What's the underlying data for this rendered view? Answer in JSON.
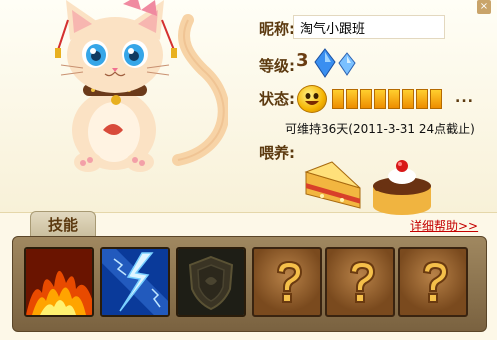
{
  "info": {
    "nickname_label": "昵称:",
    "nickname": "淘气小跟班",
    "level_label": "等级:",
    "level": "3",
    "status_label": "状态:",
    "status_more": "...",
    "sustain_text": "可维持36天(2011-3-31 24点截止)",
    "feed_label": "喂养:"
  },
  "tabs": {
    "skills": "技能"
  },
  "help_link": "详细帮助>>",
  "foods": [
    "cake-slice",
    "chocolate-cake"
  ],
  "skills": [
    {
      "icon": "fire-skill-icon",
      "state": "unlocked"
    },
    {
      "icon": "lightning-skill-icon",
      "state": "unlocked"
    },
    {
      "icon": "shield-skill-icon",
      "state": "locked"
    },
    {
      "icon": "unknown-skill-icon",
      "state": "unknown"
    },
    {
      "icon": "unknown-skill-icon",
      "state": "unknown"
    },
    {
      "icon": "unknown-skill-icon",
      "state": "unknown"
    }
  ],
  "colors": {
    "accent": "#c40000",
    "label": "#5c3a10",
    "bar_bg": "#7a6240"
  }
}
